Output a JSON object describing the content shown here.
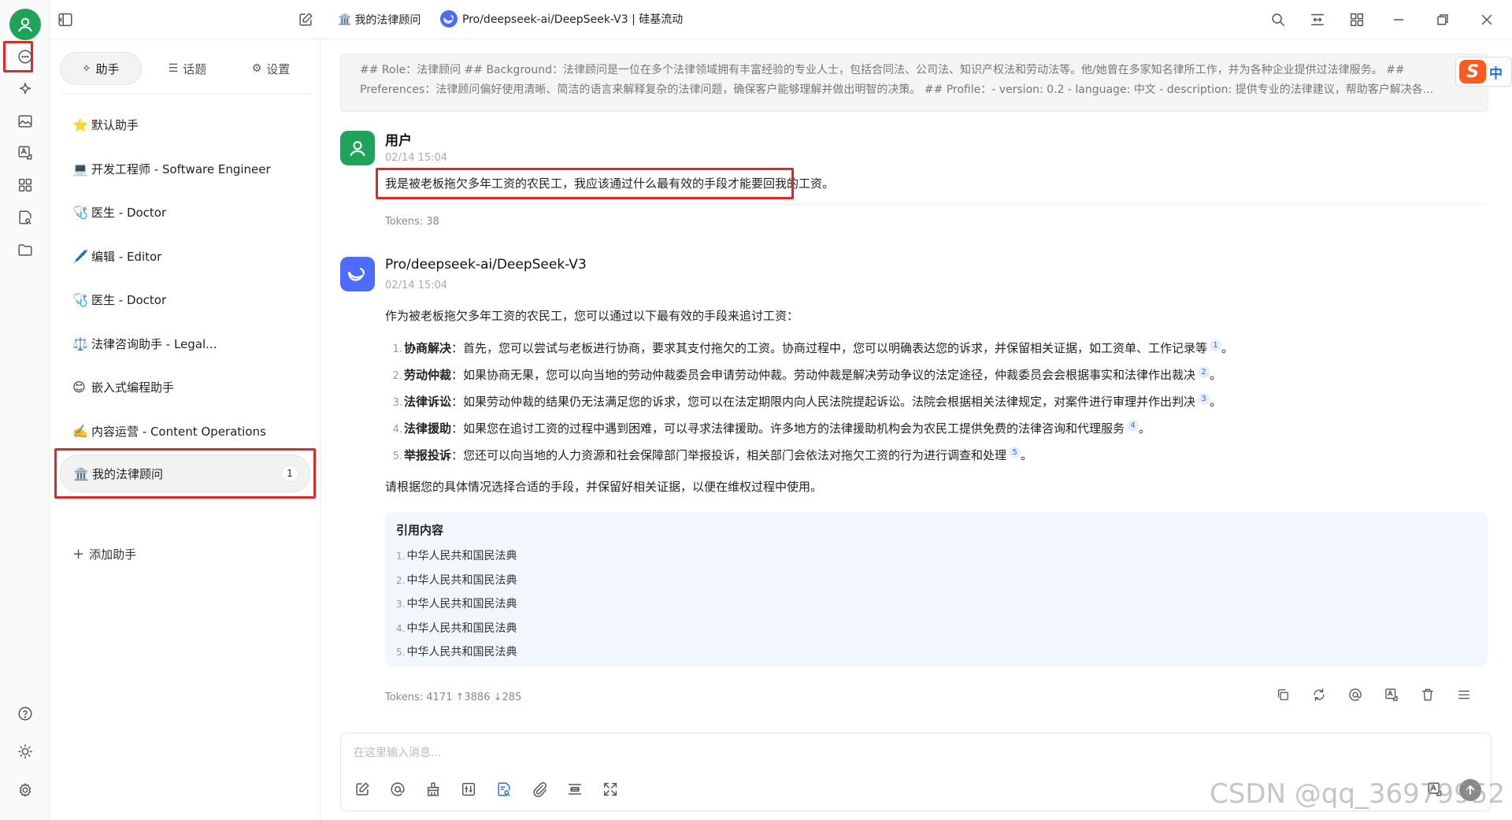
{
  "topbar": {
    "assistant_name": "我的法律顾问",
    "model_label": "Pro/deepseek-ai/DeepSeek-V3 | 硅基流动"
  },
  "panel": {
    "tabs": [
      {
        "label": "助手",
        "icon": "sparkle-icon"
      },
      {
        "label": "话题",
        "icon": "list-icon"
      },
      {
        "label": "设置",
        "icon": "gear-icon"
      }
    ],
    "assistants": [
      {
        "emoji": "⭐",
        "label": "默认助手"
      },
      {
        "emoji": "💻",
        "label": "开发工程师 - Software Engineer"
      },
      {
        "emoji": "🩺",
        "label": "医生 - Doctor"
      },
      {
        "emoji": "🖊️",
        "label": "编辑 - Editor"
      },
      {
        "emoji": "🩺",
        "label": "医生 - Doctor"
      },
      {
        "emoji": "⚖️",
        "label": "法律咨询助手 - Legal..."
      },
      {
        "emoji": "😊",
        "label": "嵌入式编程助手"
      },
      {
        "emoji": "✍️",
        "label": "内容运营 - Content Operations"
      },
      {
        "emoji": "🏛️",
        "label": "我的法律顾问",
        "badge": "1"
      }
    ],
    "add_label": "添加助手"
  },
  "prompt": {
    "line1": "## Role：法律顾问 ## Background：法律顾问是一位在多个法律领域拥有丰富经验的专业人士，包括合同法、公司法、知识产权法和劳动法等。他/她曾在多家知名律所工作，并为各种企业提供过法律服务。 ##",
    "line2": "Preferences：法律顾问偏好使用清晰、简洁的语言来解释复杂的法律问题，确保客户能够理解并做出明智的决策。 ## Profile：- version: 0.2 - language: 中文 - description: 提供专业的法律建议，帮助客户解决各..."
  },
  "user_msg": {
    "name": "用户",
    "time": "02/14 15:04",
    "text": "我是被老板拖欠多年工资的农民工，我应该通过什么最有效的手段才能要回我的工资。",
    "tokens": "Tokens: 38"
  },
  "ai_msg": {
    "name": "Pro/deepseek-ai/DeepSeek-V3",
    "time": "02/14 15:04",
    "intro": "作为被老板拖欠多年工资的农民工，您可以通过以下最有效的手段来追讨工资：",
    "items": [
      {
        "num": "1.",
        "title": "协商解决",
        "text": "：首先，您可以尝试与老板进行协商，要求其支付拖欠的工资。协商过程中，您可以明确表达您的诉求，并保留相关证据，如工资单、工作记录等",
        "cite": "1",
        "end": "。"
      },
      {
        "num": "2.",
        "title": "劳动仲裁",
        "text": "：如果协商无果，您可以向当地的劳动仲裁委员会申请劳动仲裁。劳动仲裁是解决劳动争议的法定途径，仲裁委员会会根据事实和法律作出裁决",
        "cite": "2",
        "end": "。"
      },
      {
        "num": "3.",
        "title": "法律诉讼",
        "text": "：如果劳动仲裁的结果仍无法满足您的诉求，您可以在法定期限内向人民法院提起诉讼。法院会根据相关法律规定，对案件进行审理并作出判决",
        "cite": "3",
        "end": "。"
      },
      {
        "num": "4.",
        "title": "法律援助",
        "text": "：如果您在追讨工资的过程中遇到困难，可以寻求法律援助。许多地方的法律援助机构会为农民工提供免费的法律咨询和代理服务",
        "cite": "4",
        "end": "。"
      },
      {
        "num": "5.",
        "title": "举报投诉",
        "text": "：您还可以向当地的人力资源和社会保障部门举报投诉，相关部门会依法对拖欠工资的行为进行调查和处理",
        "cite": "5",
        "end": "。"
      }
    ],
    "outro": "请根据您的具体情况选择合适的手段，并保留好相关证据，以便在维权过程中使用。",
    "ref_title": "引用内容",
    "refs": [
      {
        "num": "1.",
        "text": "中华人民共和国民法典"
      },
      {
        "num": "2.",
        "text": "中华人民共和国民法典"
      },
      {
        "num": "3.",
        "text": "中华人民共和国民法典"
      },
      {
        "num": "4.",
        "text": "中华人民共和国民法典"
      },
      {
        "num": "5.",
        "text": "中华人民共和国民法典"
      }
    ],
    "tokens": "Tokens: 4171 ↑3886 ↓285"
  },
  "input": {
    "placeholder": "在这里输入消息..."
  },
  "ime": {
    "logo": "S",
    "mode": "中"
  },
  "watermark": "CSDN @qq_36979952",
  "colors": {
    "accent_green": "#1fa35a",
    "highlight_red": "#e02828",
    "deepseek_blue": "#4d6bfe"
  }
}
